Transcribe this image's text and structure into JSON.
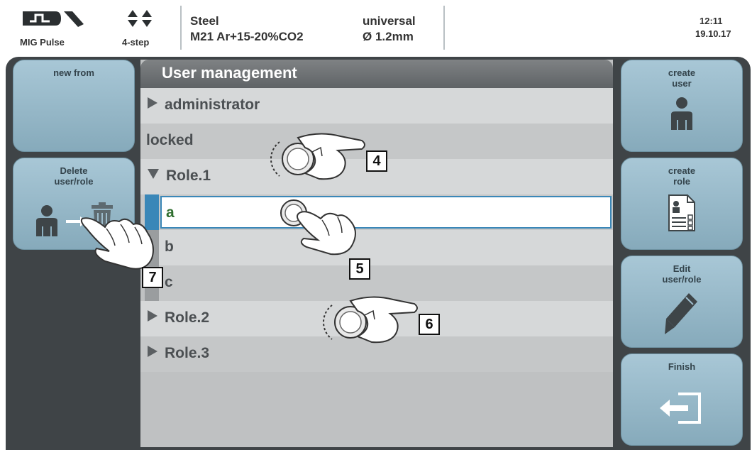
{
  "header": {
    "mode": "MIG Pulse",
    "step_mode": "4-step",
    "material": "Steel",
    "gas": "M21 Ar+15-20%CO2",
    "characteristic": "universal",
    "wire_diameter": "Ø  1.2mm",
    "time": "12:11",
    "date": "19.10.17"
  },
  "left_buttons": {
    "new_from": "new from",
    "delete_user_role_line1": "Delete",
    "delete_user_role_line2": "user/role"
  },
  "right_buttons": {
    "create_user_line1": "create",
    "create_user_line2": "user",
    "create_role_line1": "create",
    "create_role_line2": "role",
    "edit_line1": "Edit",
    "edit_line2": "user/role",
    "finish": "Finish"
  },
  "list": {
    "title": "User management",
    "rows": [
      "administrator",
      "locked",
      "Role.1",
      "a",
      "b",
      "c",
      "Role.2",
      "Role.3"
    ]
  },
  "callouts": [
    "4",
    "5",
    "6",
    "7"
  ],
  "colors": {
    "panel_bg": "#3f4447",
    "button_blue": "#9dbccc",
    "selection_border": "#3a87b8",
    "selected_text": "#2f6e2f"
  },
  "icons": [
    "pulse-mode-icon",
    "four-step-icon",
    "user-icon",
    "trash-icon",
    "role-document-icon",
    "pencil-icon",
    "exit-icon",
    "hand-pointer-icon",
    "dial-knob-icon"
  ]
}
